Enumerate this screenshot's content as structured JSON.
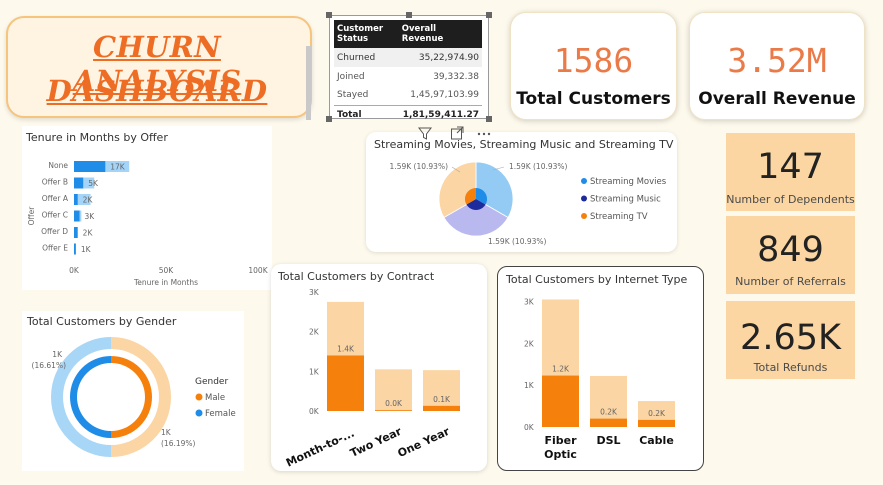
{
  "dashboard": {
    "title_line1": "CHURN ANALYSIS",
    "title_line2": "DASHBOARD"
  },
  "revenue_table": {
    "headers": [
      "Customer Status",
      "Overall Revenue"
    ],
    "rows": [
      {
        "status": "Churned",
        "revenue": "35,22,974.90"
      },
      {
        "status": "Joined",
        "revenue": "39,332.38"
      },
      {
        "status": "Stayed",
        "revenue": "1,45,97,103.99"
      }
    ],
    "total": {
      "status": "Total",
      "revenue": "1,81,59,411.27"
    }
  },
  "kpis": {
    "total_customers": {
      "value": "1586",
      "label": "Total Customers"
    },
    "overall_revenue": {
      "value": "3.52M",
      "label": "Overall Revenue"
    },
    "dependents": {
      "value": "147",
      "label": "Number of Dependents"
    },
    "referrals": {
      "value": "849",
      "label": "Number of Referrals"
    },
    "refunds": {
      "value": "2.65K",
      "label": "Total Refunds"
    }
  },
  "visual_header_icons": [
    "filter-icon",
    "focus-mode-icon",
    "more-options-icon"
  ],
  "colors": {
    "accent_orange": "#f5800c",
    "light_orange": "#fbd6a3",
    "blue": "#1f8ce8",
    "light_blue": "#a4d4f7",
    "navy": "#1d2b9c",
    "kpi_orange": "#ea7a47"
  },
  "chart_data": [
    {
      "type": "bar",
      "title": "Tenure in Months by Offer",
      "xlabel": "Tenure in Months",
      "ylabel": "Offer",
      "orientation": "horizontal",
      "categories": [
        "None",
        "Offer B",
        "Offer A",
        "Offer C",
        "Offer D",
        "Offer E"
      ],
      "data_labels": [
        "17K",
        "5K",
        "2K",
        "3K",
        "2K",
        "1K"
      ],
      "series": [
        {
          "values": [
            17000,
            5000,
            2000,
            3000,
            2000,
            1000
          ]
        },
        {
          "values": [
            30000,
            11000,
            9000,
            4000,
            2000,
            1000
          ]
        }
      ],
      "xticks": [
        "0K",
        "50K",
        "100K"
      ],
      "xlim": [
        0,
        100000
      ]
    },
    {
      "type": "pie",
      "title": "Streaming Movies, Streaming Music and Streaming TV",
      "legend": [
        "Streaming Movies",
        "Streaming Music",
        "Streaming TV"
      ],
      "slice_labels": [
        "1.59K (10.93%)",
        "1.59K (10.93%)",
        "1.59K (10.93%)"
      ]
    },
    {
      "type": "bar",
      "title": "Total Customers by Contract",
      "categories": [
        "Month-to-...",
        "Two Year",
        "One Year"
      ],
      "data_labels": [
        "1.4K",
        "0.0K",
        "0.1K"
      ],
      "series": [
        {
          "values": [
            1400,
            20,
            130
          ]
        },
        {
          "values": [
            2750,
            1050,
            1030
          ]
        }
      ],
      "yticks": [
        "0K",
        "1K",
        "2K",
        "3K"
      ],
      "ylim": [
        0,
        3000
      ]
    },
    {
      "type": "bar",
      "title": "Total Customers by Internet Type",
      "categories": [
        "Fiber Optic",
        "DSL",
        "Cable"
      ],
      "data_labels": [
        "1.2K",
        "0.2K",
        "0.2K"
      ],
      "series": [
        {
          "values": [
            1230,
            200,
            170
          ]
        },
        {
          "values": [
            3050,
            1220,
            620
          ]
        }
      ],
      "yticks": [
        "0K",
        "1K",
        "2K",
        "3K"
      ],
      "ylim": [
        0,
        3300
      ]
    },
    {
      "type": "pie",
      "title": "Total Customers by Gender",
      "legend_title": "Gender",
      "legend": [
        "Male",
        "Female"
      ],
      "slice_labels": [
        "1K\n(16.61%)",
        "1K\n(16.19%)"
      ]
    }
  ]
}
